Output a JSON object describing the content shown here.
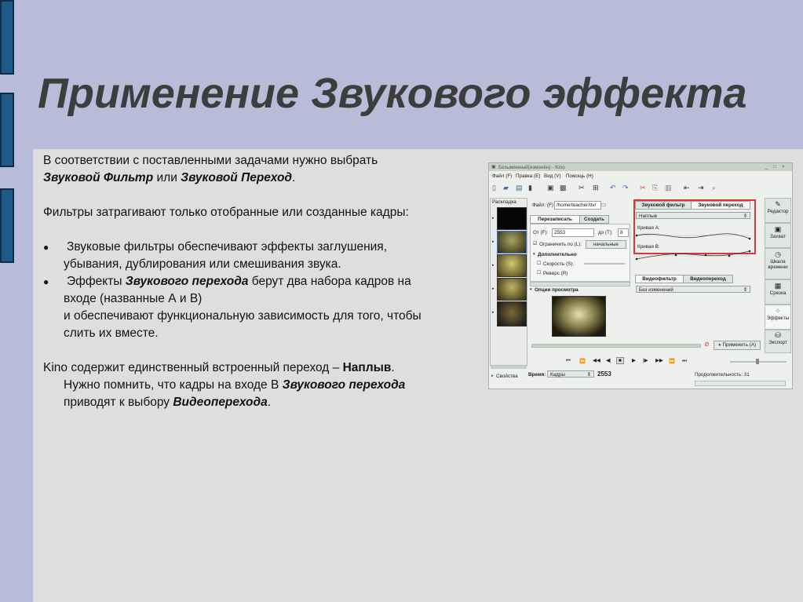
{
  "slide": {
    "title": "Применение Звукового эффекта",
    "intro": {
      "part1": "В соответствии с поставленными задачами нужно выбрать ",
      "filter": "Звуковой Фильтр",
      "or": " или ",
      "transition": "Звуковой Переход",
      "end": "."
    },
    "filters_note": "Фильтры затрагивают только отобранные или созданные кадры:",
    "bullet1": {
      "line1": "Звуковые фильтры обеспечивают эффекты заглушения,",
      "line2": "убывания, дублирования или смешивания звука."
    },
    "bullet2": {
      "pre": "Эффекты ",
      "bold": "Звукового перехода",
      "post": " берут два набора кадров на",
      "line2": "входе (названные А и В)",
      "line3": "и обеспечивают функциональную зависимость для того, чтобы",
      "line4": "слить их вместе."
    },
    "kino": {
      "pre": "Kino содержит единственный встроенный переход – ",
      "bold": "Наплыв",
      "end": ".",
      "line2_pre": "Нужно помнить, что кадры на входе В ",
      "line2_bold": "Звукового перехода",
      "line3_pre": "приводят к выбору ",
      "line3_bold": "Видеоперехода",
      "line3_end": "."
    }
  },
  "screenshot": {
    "window_title": "Безымянный(изменён) - Kino",
    "menu": [
      "Файл (F)",
      "Правка (E)",
      "Вид (V)",
      "Помощь (H)"
    ],
    "storyboard_label": "Раскладка",
    "file_label": "Файл: (F)",
    "file_value": "/home/teacher/dv/",
    "tabs_left": [
      "Перезаписать",
      "Создать"
    ],
    "from_label": "От (F):",
    "from_value": "2553",
    "to_label": "до (T):",
    "to_value": "8",
    "limit_label": "Ограничить по (L):",
    "limit_value": "начальные",
    "additional_label": "Дополнительно",
    "speed_label": "Скорость (S):",
    "reverse_label": "Реверс (R)",
    "preview_label": "Опции просмотра",
    "audio_tabs": [
      "Звуковой фильтр",
      "Звуковой переход"
    ],
    "audio_select": "Наплыв",
    "curve_a": "Кривая А:",
    "curve_b": "Кривая В:",
    "video_tabs": [
      "Видеофильтр",
      "Видеопереход"
    ],
    "video_select": "Без изменений",
    "apply_label": "Применить (A)",
    "properties_label": "Свойства",
    "time_label": "Время:",
    "time_unit": "Кадры",
    "frame_value": "2553",
    "duration_label": "Продолжительность: 31",
    "side_buttons": [
      "Редактор",
      "Захват",
      "Шкала времени",
      "Срезка",
      "Эффекты",
      "Экспорт"
    ]
  },
  "colors": {
    "background": "#b8bcd8",
    "content_bg": "#dedede",
    "accent_bar": "#1f5a86",
    "highlight_red": "#d9373a"
  }
}
